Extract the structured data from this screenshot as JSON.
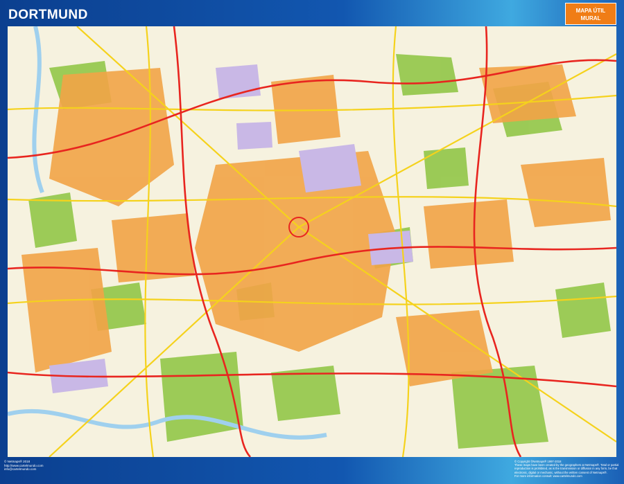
{
  "title": "DORTMUND",
  "badge": {
    "line1": "MAPA ÚTIL",
    "line2": "MURAL"
  },
  "footer_left": [
    "© Netmaps® 2018",
    "http://www.cartelmundo.com",
    "info@cartelmundo.com"
  ],
  "footer_right": [
    "© Copyright ©Netmaps® 1997-2018",
    "These maps have been created by the geographers at Netmaps®. Total or partial",
    "reproduction is prohibited, as is the transmission or diffusion in any form, be that",
    "electronic, digital or mechanic, without the written consent of Netmaps®.",
    "For more information consult: www.cartelmundo.com"
  ],
  "colors": {
    "frame": "#0b3f8f",
    "badge": "#f07d16",
    "urban": "#f2a447",
    "park": "#8cc43f",
    "industrial": "#c9b8e6",
    "water": "#9fd0ee",
    "motorway": "#e8251f",
    "main_road": "#f5d21c",
    "background": "#f6f2df"
  }
}
